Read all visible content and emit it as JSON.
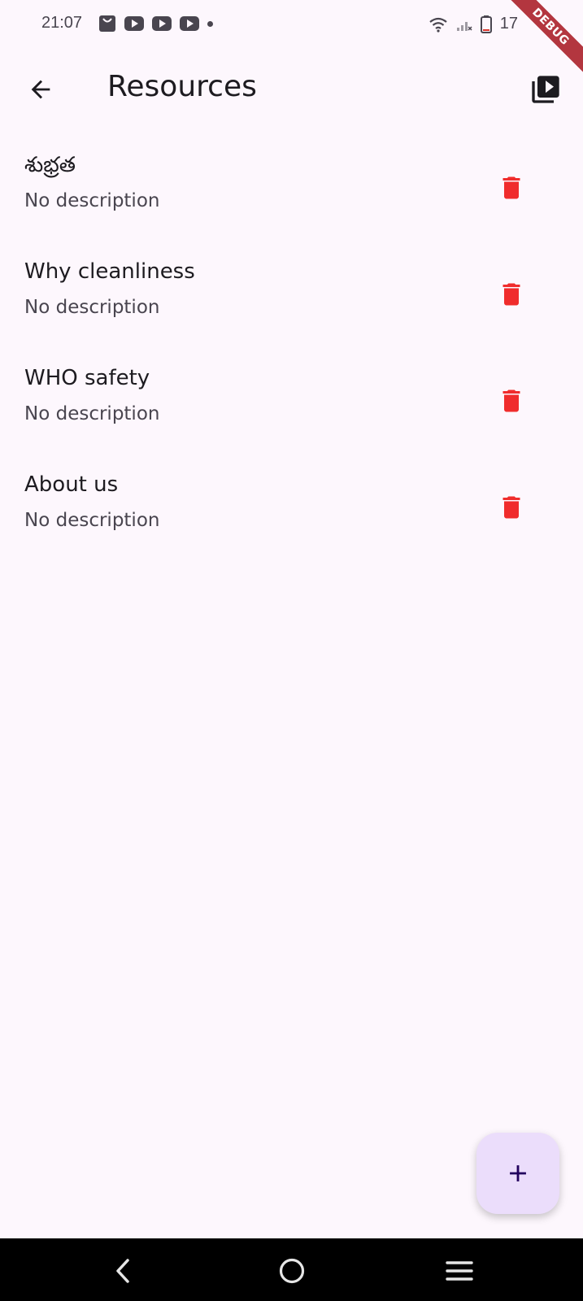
{
  "status_bar": {
    "time": "21:07",
    "battery_level": "17",
    "left_icons": [
      "shopping-bag-icon",
      "youtube-icon",
      "youtube-icon",
      "youtube-icon",
      "dot-icon"
    ],
    "right_icons": [
      "wifi-icon",
      "signal-icon",
      "battery-icon"
    ]
  },
  "debug_banner": "DEBUG",
  "app_bar": {
    "back_icon": "arrow-back-icon",
    "title": "Resources",
    "action_icon": "video-library-icon"
  },
  "resources": [
    {
      "title": "శుభ్రత",
      "description": "No description"
    },
    {
      "title": "Why cleanliness",
      "description": "No description"
    },
    {
      "title": "WHO safety",
      "description": "No description"
    },
    {
      "title": "About us",
      "description": "No description"
    }
  ],
  "fab": {
    "icon": "plus-icon"
  },
  "colors": {
    "background": "#fdf7fd",
    "delete": "#f02c2c",
    "fab_bg": "#ebddfb",
    "fab_icon": "#21005d",
    "text_primary": "#1d1b20",
    "text_secondary": "#49454f"
  },
  "nav_bar": {
    "buttons": [
      "nav-back-icon",
      "nav-home-icon",
      "nav-recents-icon"
    ]
  }
}
